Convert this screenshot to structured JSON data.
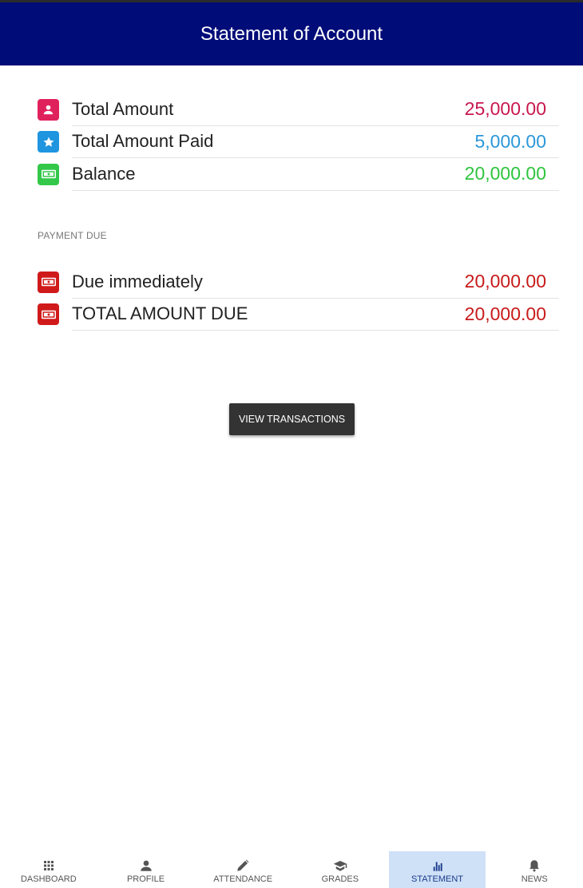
{
  "header": {
    "title": "Statement of Account"
  },
  "summary": [
    {
      "label": "Total Amount",
      "value": "25,000.00",
      "icon": "person-icon",
      "icon_color": "#e0225c",
      "value_color": "#c8174e"
    },
    {
      "label": "Total Amount Paid",
      "value": "5,000.00",
      "icon": "star-icon",
      "icon_color": "#1f95e0",
      "value_color": "#2b97d9"
    },
    {
      "label": "Balance",
      "value": "20,000.00",
      "icon": "cash-icon",
      "icon_color": "#33c84a",
      "value_color": "#2ec43e"
    }
  ],
  "payment_due": {
    "section_label": "PAYMENT DUE",
    "items": [
      {
        "label": "Due immediately",
        "value": "20,000.00",
        "icon": "cash-icon",
        "icon_color": "#d01a1a",
        "value_color": "#c81a1a"
      },
      {
        "label": "TOTAL AMOUNT DUE",
        "value": "20,000.00",
        "icon": "cash-icon",
        "icon_color": "#d01a1a",
        "value_color": "#c81a1a"
      }
    ]
  },
  "actions": {
    "view_transactions": "VIEW TRANSACTIONS"
  },
  "nav": {
    "items": [
      {
        "label": "DASHBOARD",
        "icon": "grid-icon"
      },
      {
        "label": "PROFILE",
        "icon": "person-icon"
      },
      {
        "label": "ATTENDANCE",
        "icon": "pencil-icon"
      },
      {
        "label": "GRADES",
        "icon": "graduation-cap-icon"
      },
      {
        "label": "STATEMENT",
        "icon": "bar-chart-icon",
        "active": true
      },
      {
        "label": "NEWS",
        "icon": "bell-icon"
      }
    ]
  }
}
